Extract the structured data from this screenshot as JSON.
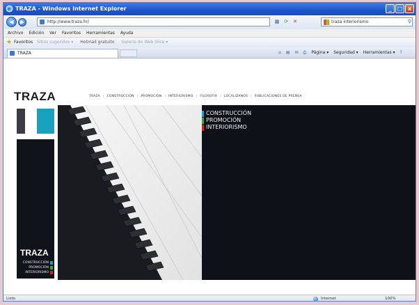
{
  "window": {
    "title": "TRAZA - Windows Internet Explorer",
    "controls": {
      "minimize": "_",
      "maximize": "□",
      "close": "x"
    }
  },
  "addressbar": {
    "url": "http://www.traza.hr/",
    "search_value": "traza interiorismo",
    "go_icon": "refresh-icon"
  },
  "menu": {
    "items": [
      "Archivo",
      "Edición",
      "Ver",
      "Favoritos",
      "Herramientas",
      "Ayuda"
    ]
  },
  "favorites": {
    "label": "Favoritos",
    "items": [
      "Sitios sugeridos ▾",
      "Hotmail gratuito",
      "Galería de Web Slice ▾"
    ]
  },
  "tab": {
    "label": "TRAZA"
  },
  "commands": {
    "page": "Página ▾",
    "security": "Seguridad ▾",
    "tools": "Herramientas ▾"
  },
  "site": {
    "logo": "TRAZA",
    "nav": [
      "TRAZA",
      "CONSTRUCCIÓN",
      "PROMOCIÓN",
      "INTERIORISMO",
      "FILOSOFÍA",
      "LOCALIZANOS",
      "PUBLICACIONES DE PRENSA"
    ],
    "sidebar_logo": "TRAZA",
    "sidebar_items": [
      {
        "label": "CONSTRUCCIÓN",
        "color": "#1aa0bf"
      },
      {
        "label": "PROMOCIÓN",
        "color": "#3ba33a"
      },
      {
        "label": "INTERIORISMO",
        "color": "#c8262c"
      }
    ],
    "panel_items": [
      {
        "label": "CONSTRUCCIÓN",
        "color": "#1aa0bf"
      },
      {
        "label": "PROMOCIÓN",
        "color": "#3ba33a"
      },
      {
        "label": "INTERIORISMO",
        "color": "#c8262c"
      }
    ]
  },
  "status": {
    "left": "Listo",
    "zone": "Internet",
    "zoom": "100%"
  }
}
